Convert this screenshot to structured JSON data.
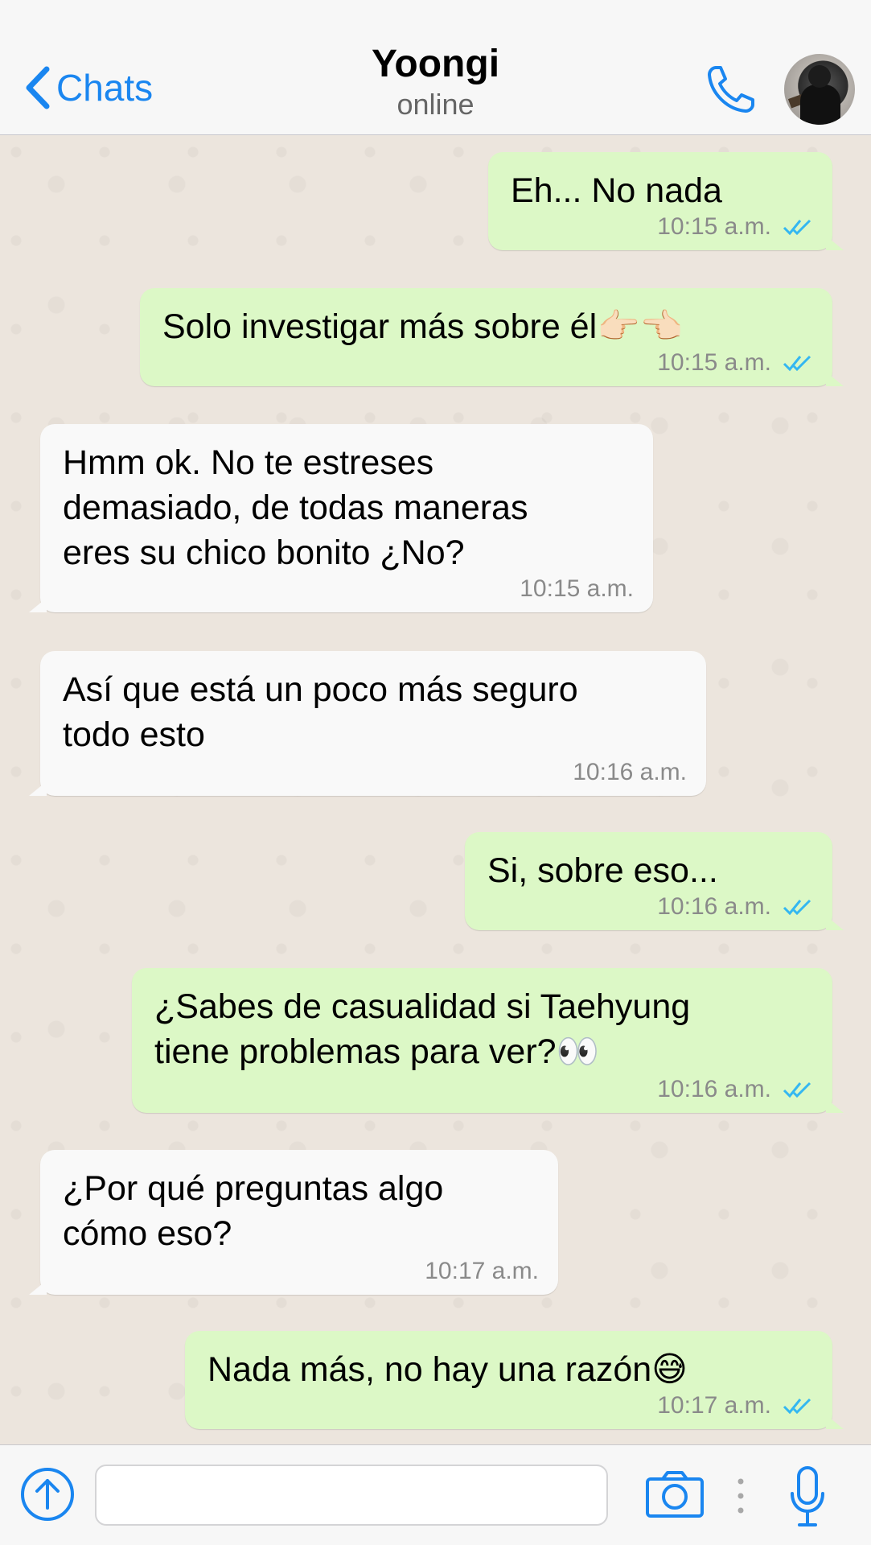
{
  "header": {
    "back_label": "Chats",
    "contact_name": "Yoongi",
    "status": "online"
  },
  "colors": {
    "accent": "#1a86f0",
    "outgoing_bubble": "#dcf8c6",
    "incoming_bubble": "#f9f9f9",
    "chat_background": "#ece5dd",
    "read_ticks": "#34b7f1"
  },
  "messages": [
    {
      "direction": "out",
      "text": "Eh... No nada",
      "time": "10:15 a.m.",
      "read": true
    },
    {
      "direction": "out",
      "text": "Solo investigar más sobre él👉🏻👈🏻",
      "time": "10:15 a.m.",
      "read": true
    },
    {
      "direction": "in",
      "text": "Hmm ok. No te estreses\ndemasiado, de todas maneras\neres su chico bonito ¿No?",
      "time": "10:15 a.m."
    },
    {
      "direction": "in",
      "text": "Así que está un poco más seguro\ntodo esto",
      "time": "10:16 a.m."
    },
    {
      "direction": "out",
      "text": "Si, sobre eso...",
      "time": "10:16 a.m.",
      "read": true
    },
    {
      "direction": "out",
      "text": "¿Sabes de casualidad si Taehyung\ntiene problemas para ver?👀",
      "time": "10:16 a.m.",
      "read": true
    },
    {
      "direction": "in",
      "text": "¿Por qué preguntas algo\ncómo eso?",
      "time": "10:17 a.m."
    },
    {
      "direction": "out",
      "text": "Nada más, no hay una razón😅",
      "time": "10:17 a.m.",
      "read": true
    }
  ],
  "input": {
    "value": "",
    "placeholder": ""
  },
  "icons": {
    "back": "chevron-left-icon",
    "call": "phone-icon",
    "upload": "upload-arrow-icon",
    "camera": "camera-icon",
    "more": "vertical-dots-icon",
    "mic": "microphone-icon",
    "ticks": "double-check-icon"
  }
}
